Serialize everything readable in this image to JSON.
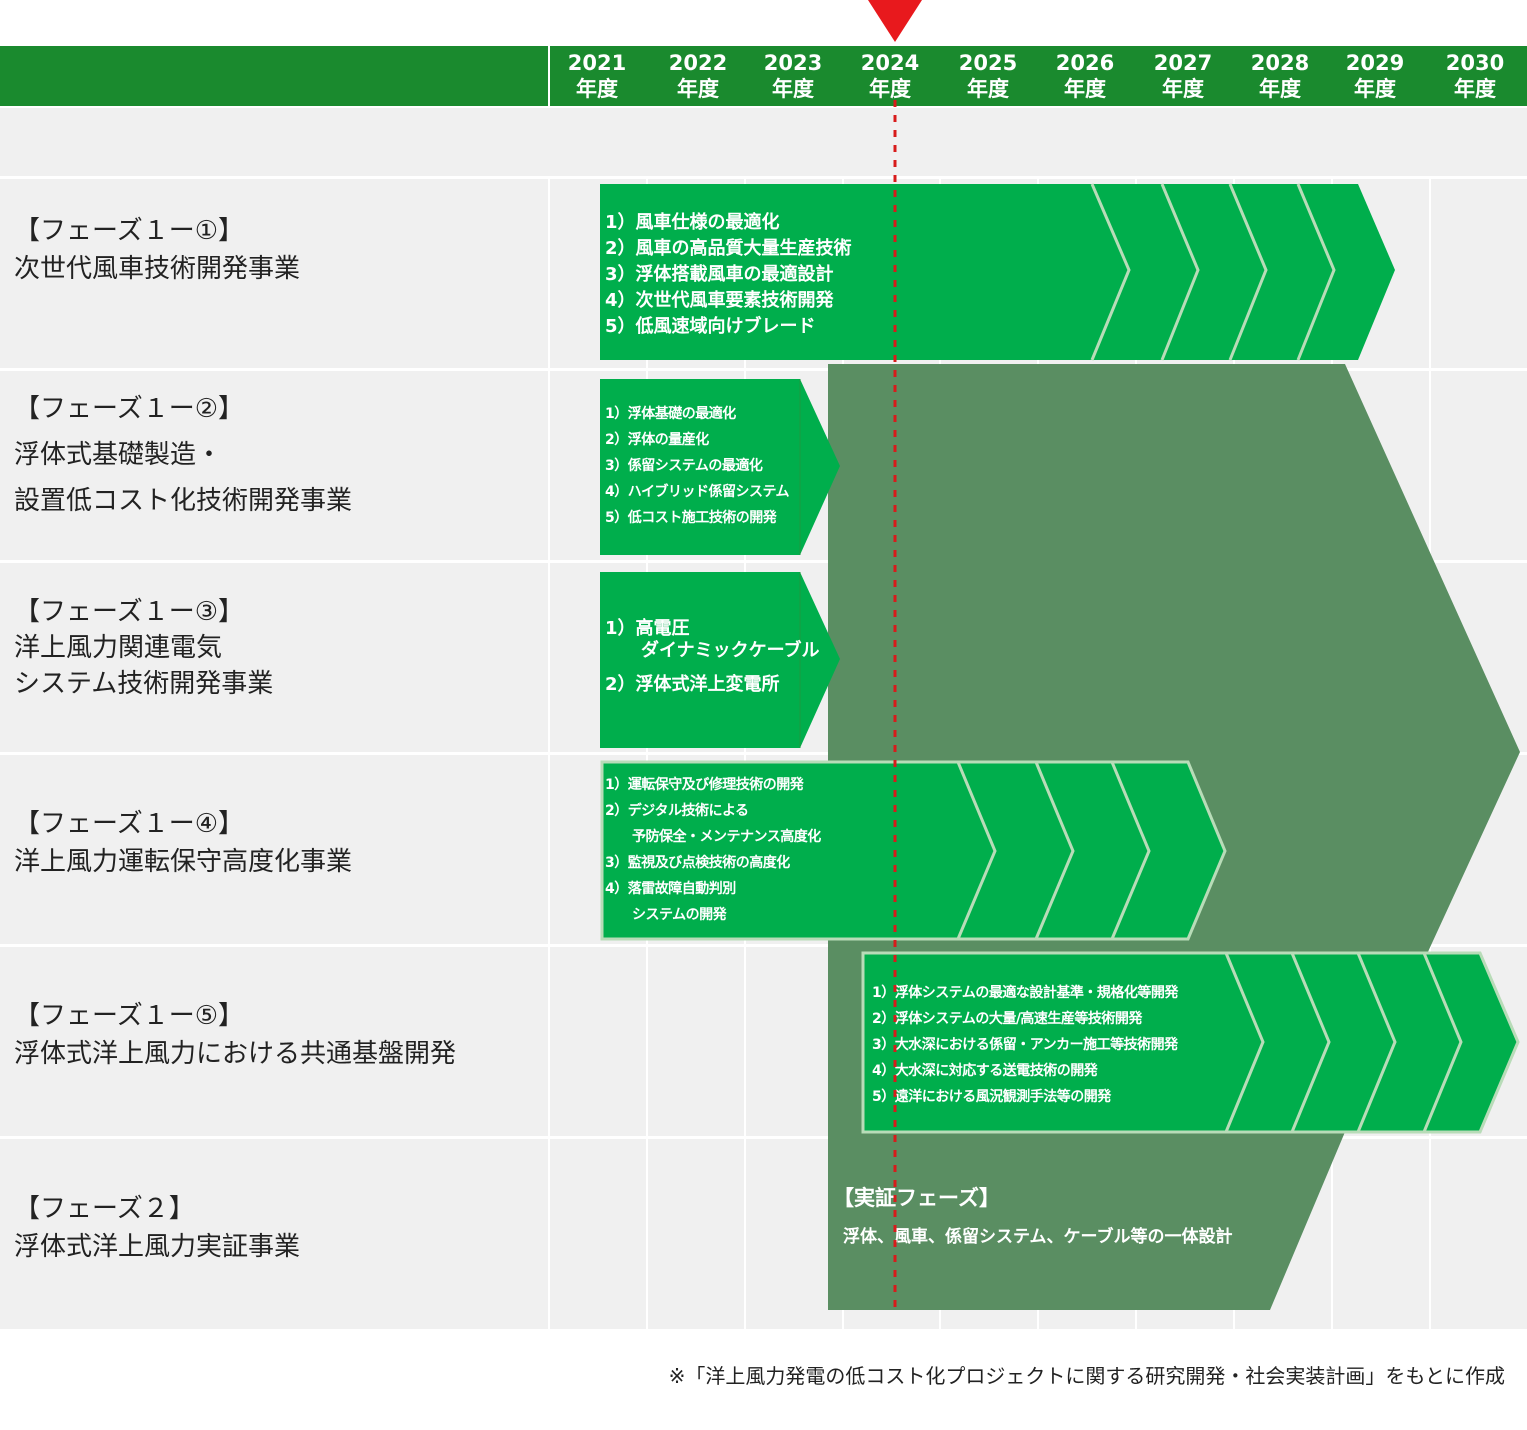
{
  "years": [
    {
      "year": "2021",
      "unit": "年度"
    },
    {
      "year": "2022",
      "unit": "年度"
    },
    {
      "year": "2023",
      "unit": "年度"
    },
    {
      "year": "2024",
      "unit": "年度"
    },
    {
      "year": "2025",
      "unit": "年度"
    },
    {
      "year": "2026",
      "unit": "年度"
    },
    {
      "year": "2027",
      "unit": "年度"
    },
    {
      "year": "2028",
      "unit": "年度"
    },
    {
      "year": "2029",
      "unit": "年度"
    },
    {
      "year": "2030",
      "unit": "年度"
    }
  ],
  "current_year_marker": "2024",
  "colors": {
    "header": "#1a8a2e",
    "task_arrow": "#00ae4c",
    "demo_phase": "#5a8e62",
    "marker": "#e8191d",
    "row_bg": "#f0f0f0"
  },
  "rows": [
    {
      "label": [
        "【フェーズ１ー①】",
        "次世代風車技術開発事業"
      ],
      "items": [
        "1）風車仕様の最適化",
        "2）風車の高品質大量生産技術",
        "3）浮体搭載風車の最適設計",
        "4）次世代風車要素技術開発",
        "5）低風速域向けブレード"
      ]
    },
    {
      "label": [
        "【フェーズ１ー②】",
        "浮体式基礎製造・",
        "設置低コスト化技術開発事業"
      ],
      "items": [
        "1）浮体基礎の最適化",
        "2）浮体の量産化",
        "3）係留システムの最適化",
        "4）ハイブリッド係留システム",
        "5）低コスト施工技術の開発"
      ]
    },
    {
      "label": [
        "【フェーズ１ー③】",
        "洋上風力関連電気",
        "システム技術開発事業"
      ],
      "items": [
        "1）高電圧",
        "　　ダイナミックケーブル",
        "2）浮体式洋上変電所"
      ]
    },
    {
      "label": [
        "【フェーズ１ー④】",
        "洋上風力運転保守高度化事業"
      ],
      "items": [
        "1）運転保守及び修理技術の開発",
        "2）デジタル技術による",
        "　　予防保全・メンテナンス高度化",
        "3）監視及び点検技術の高度化",
        "4）落雷故障自動判別",
        "　　システムの開発"
      ]
    },
    {
      "label": [
        "【フェーズ１ー⑤】",
        "浮体式洋上風力における共通基盤開発"
      ],
      "items": [
        "1）浮体システムの最適な設計基準・規格化等開発",
        "2）浮体システムの大量/高速生産等技術開発",
        "3）大水深における係留・アンカー施工等技術開発",
        "4）大水深に対応する送電技術の開発",
        "5）遠洋における風況観測手法等の開発"
      ]
    },
    {
      "label": [
        "【フェーズ２】",
        "浮体式洋上風力実証事業"
      ],
      "items": []
    }
  ],
  "demo_phase": {
    "title": "【実証フェーズ】",
    "description": "浮体、風車、係留システム、ケーブル等の一体設計"
  },
  "footnote": "※「洋上風力発電の低コスト化プロジェクトに関する研究開発・社会実装計画」をもとに作成"
}
